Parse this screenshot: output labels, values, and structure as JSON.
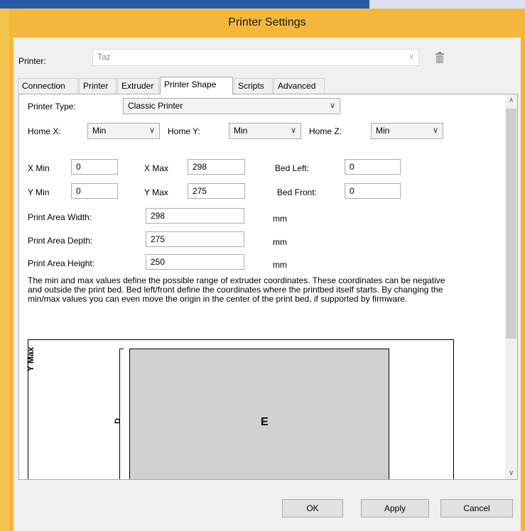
{
  "window": {
    "title": "Printer Settings"
  },
  "printer": {
    "label": "Printer:",
    "value": "Taz"
  },
  "tabs": [
    {
      "label": "Connection"
    },
    {
      "label": "Printer"
    },
    {
      "label": "Extruder"
    },
    {
      "label": "Printer Shape"
    },
    {
      "label": "Scripts"
    },
    {
      "label": "Advanced"
    }
  ],
  "shape": {
    "printer_type_label": "Printer Type:",
    "printer_type_value": "Classic Printer",
    "home_x_label": "Home X:",
    "home_x_value": "Min",
    "home_y_label": "Home Y:",
    "home_y_value": "Min",
    "home_z_label": "Home Z:",
    "home_z_value": "Min",
    "x_min_label": "X Min",
    "x_min_value": "0",
    "x_max_label": "X Max",
    "x_max_value": "298",
    "bed_left_label": "Bed Left:",
    "bed_left_value": "0",
    "y_min_label": "Y Min",
    "y_min_value": "0",
    "y_max_label": "Y Max",
    "y_max_value": "275",
    "bed_front_label": "Bed Front:",
    "bed_front_value": "0",
    "width_label": "Print Area Width:",
    "width_value": "298",
    "width_unit": "mm",
    "depth_label": "Print Area Depth:",
    "depth_value": "275",
    "depth_unit": "mm",
    "height_label": "Print Area Height:",
    "height_value": "250",
    "height_unit": "mm",
    "description": "The min and max values define the possible range of extruder coordinates. These coordinates can be negative and outside the print bed. Bed left/front define the coordinates where the printbed itself starts. By changing the min/max values you can even move the origin in the center of the print bed, if supported by firmware."
  },
  "diagram": {
    "y_axis": "Y Max",
    "dimension": "D",
    "bed": "E"
  },
  "buttons": {
    "ok": "OK",
    "apply": "Apply",
    "cancel": "Cancel"
  },
  "colors": {
    "title_bar": "#f4b73c",
    "panel_bg": "#ffffff",
    "bed_fill": "#d0d0d0"
  }
}
